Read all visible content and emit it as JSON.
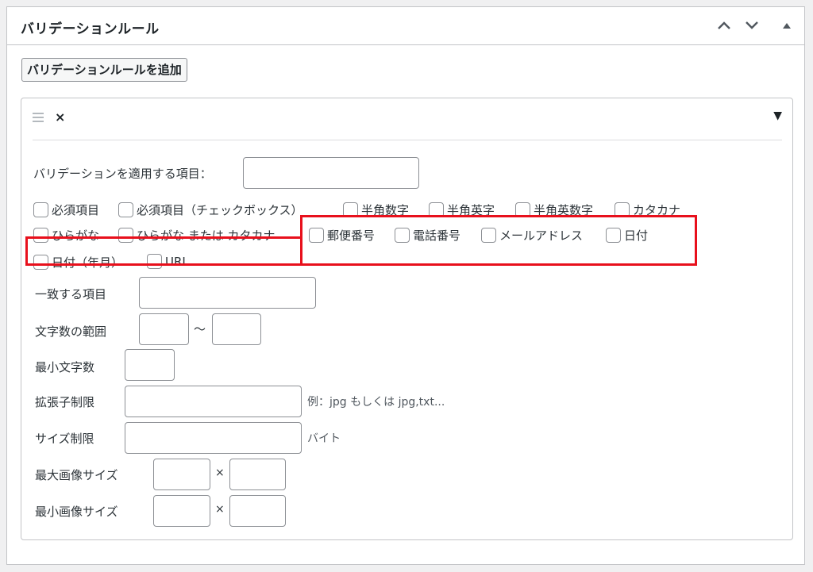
{
  "metabox": {
    "title": "バリデーションルール",
    "collapse_up_icon": "chevron-up-icon",
    "collapse_down_icon": "chevron-down-icon",
    "toggle_icon": "triangle-up-icon"
  },
  "add_button_label": "バリデーションルールを追加",
  "rule": {
    "remove_label": "×",
    "toggle_label": "▼",
    "target_field_label": "バリデーションを適用する項目：",
    "target_field_value": "",
    "checkboxes": [
      {
        "label": "必須項目",
        "checked": false
      },
      {
        "label": "必須項目（チェックボックス）",
        "checked": false
      },
      {
        "label": "半角数字",
        "checked": false
      },
      {
        "label": "半角英字",
        "checked": false
      },
      {
        "label": "半角英数字",
        "checked": false
      },
      {
        "label": "カタカナ",
        "checked": false
      },
      {
        "label": "ひらがな",
        "checked": false
      },
      {
        "label": "ひらがな または カタカナ",
        "checked": false
      },
      {
        "label": "郵便番号",
        "checked": false
      },
      {
        "label": "電話番号",
        "checked": false
      },
      {
        "label": "メールアドレス",
        "checked": false
      },
      {
        "label": "日付",
        "checked": false
      },
      {
        "label": "日付（年月）",
        "checked": false
      },
      {
        "label": "URL",
        "checked": false
      }
    ],
    "match_label": "一致する項目",
    "length_range_label": "文字数の範囲",
    "range_separator": "〜",
    "min_length_label": "最小文字数",
    "extension_label": "拡張子制限",
    "extension_hint": "例：jpg もしくは jpg,txt...",
    "size_label": "サイズ制限",
    "size_unit": "バイト",
    "max_image_label": "最大画像サイズ",
    "min_image_label": "最小画像サイズ",
    "times_sign": "×"
  },
  "colors": {
    "highlight": "#e8101c",
    "border": "#8c8f94",
    "background": "#f0f0f1"
  }
}
